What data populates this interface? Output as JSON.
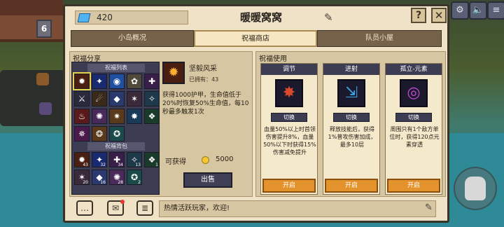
{
  "header": {
    "gems": "420",
    "title": "暖暖窝窝",
    "help_label": "?",
    "close_label": "✕"
  },
  "background": {
    "house_level": "6"
  },
  "tabs": [
    "小岛概况",
    "祝福商店",
    "队员小屋"
  ],
  "blessing_share": {
    "title": "祝福分享",
    "list_title": "祝福列表",
    "bag_title": "祝福背包",
    "list_cells": [
      {
        "sym": "✹",
        "color": "#4a1e10",
        "icon": "blessing-sun-icon",
        "num": ""
      },
      {
        "sym": "✦",
        "color": "#1a2a6e",
        "icon": "blessing-star-icon",
        "num": ""
      },
      {
        "sym": "◉",
        "color": "#1f4fa0",
        "icon": "blessing-orb-icon",
        "num": ""
      },
      {
        "sym": "✿",
        "color": "#4f4a3c",
        "icon": "blessing-flower-icon",
        "num": ""
      },
      {
        "sym": "✚",
        "color": "#3a1e4a",
        "icon": "blessing-cross-icon",
        "num": ""
      },
      {
        "sym": "⚔",
        "color": "#2a2a3c",
        "icon": "blessing-sword-icon",
        "num": ""
      },
      {
        "sym": "☄",
        "color": "#3a2a1a",
        "icon": "blessing-comet-icon",
        "num": ""
      },
      {
        "sym": "◆",
        "color": "#2a3a6e",
        "icon": "blessing-diamond-icon",
        "num": ""
      },
      {
        "sym": "✶",
        "color": "#3a2a3a",
        "icon": "blessing-spark-icon",
        "num": ""
      },
      {
        "sym": "✧",
        "color": "#1e3a4a",
        "icon": "blessing-twinkle-icon",
        "num": ""
      },
      {
        "sym": "♨",
        "color": "#5a1a1a",
        "icon": "blessing-flame-icon",
        "num": ""
      },
      {
        "sym": "✺",
        "color": "#4a2a5a",
        "icon": "blessing-burst-icon",
        "num": ""
      },
      {
        "sym": "✷",
        "color": "#5a3a1a",
        "icon": "blessing-ray-icon",
        "num": ""
      },
      {
        "sym": "✸",
        "color": "#1a3a5a",
        "icon": "blessing-shard-icon",
        "num": ""
      },
      {
        "sym": "❖",
        "color": "#1a3a2a",
        "icon": "blessing-rune-icon",
        "num": ""
      },
      {
        "sym": "✵",
        "color": "#4a1a4a",
        "icon": "blessing-lotus-icon",
        "num": ""
      },
      {
        "sym": "❂",
        "color": "#5a3a1a",
        "icon": "blessing-shield-icon",
        "num": ""
      },
      {
        "sym": "✪",
        "color": "#1a4a4a",
        "icon": "blessing-gem-icon",
        "num": ""
      }
    ],
    "bag_cells": [
      {
        "sym": "✹",
        "color": "#4a1e10",
        "icon": "blessing-sun-icon",
        "num": "43"
      },
      {
        "sym": "✦",
        "color": "#1a2a6e",
        "icon": "blessing-star-icon",
        "num": "32"
      },
      {
        "sym": "✚",
        "color": "#3a1e4a",
        "icon": "blessing-cross-icon",
        "num": "34"
      },
      {
        "sym": "✧",
        "color": "#1e3a4a",
        "icon": "blessing-twinkle-icon",
        "num": "13"
      },
      {
        "sym": "❖",
        "color": "#1a3a2a",
        "icon": "blessing-rune-icon",
        "num": "1"
      },
      {
        "sym": "✶",
        "color": "#3a2a3a",
        "icon": "blessing-spark-icon",
        "num": "20"
      },
      {
        "sym": "◆",
        "color": "#2a3a6e",
        "icon": "blessing-diamond-icon",
        "num": "16"
      },
      {
        "sym": "✺",
        "color": "#4a2a5a",
        "icon": "blessing-burst-icon",
        "num": "28"
      },
      {
        "sym": "✪",
        "color": "#1a4a4a",
        "icon": "blessing-gem-icon",
        "num": "2"
      }
    ]
  },
  "detail": {
    "name": "坚毅风采",
    "owned": "已拥有：43",
    "desc": "获得1000护甲，生命值低于20%时恢复50%生命值，每10秒最多触发1次",
    "get_label": "可获得",
    "get_value": "5000",
    "sell_label": "出售"
  },
  "blessing_use": {
    "title": "祝福使用",
    "switch_label": "切换",
    "open_label": "开启",
    "cards": [
      {
        "title": "调节",
        "icon_sym": "✸",
        "icon_color": "#d84a2a",
        "desc": "血量50%以上时首领伤害提升8%，血量50%以下时获得15%伤害减免提升"
      },
      {
        "title": "进射",
        "icon_sym": "⇲",
        "icon_color": "#3aa6e8",
        "desc": "释放技能后，获得1%普攻伤害加成，最多10层"
      },
      {
        "title": "孤立-元素",
        "icon_sym": "◎",
        "icon_color": "#c648d8",
        "desc": "周围只有1个敌方单位时，获得120点元素穿透"
      }
    ]
  },
  "chat": {
    "message": "热情活跃玩家，欢迎!"
  }
}
